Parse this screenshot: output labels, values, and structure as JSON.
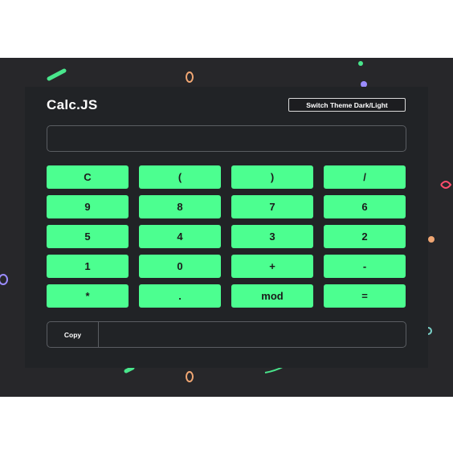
{
  "app": {
    "title": "Calc.JS"
  },
  "toolbar": {
    "theme_label": "Switch Theme Dark/Light"
  },
  "display": {
    "expression": ""
  },
  "keys": [
    "C",
    "(",
    ")",
    "/",
    "9",
    "8",
    "7",
    "6",
    "5",
    "4",
    "3",
    "2",
    "1",
    "0",
    "+",
    "-",
    "*",
    ".",
    "mod",
    "="
  ],
  "result": {
    "copy_label": "Copy",
    "value": ""
  },
  "colors": {
    "background": "#27272a",
    "card": "#212326",
    "key": "#4cff90",
    "text": "#ffffff"
  }
}
